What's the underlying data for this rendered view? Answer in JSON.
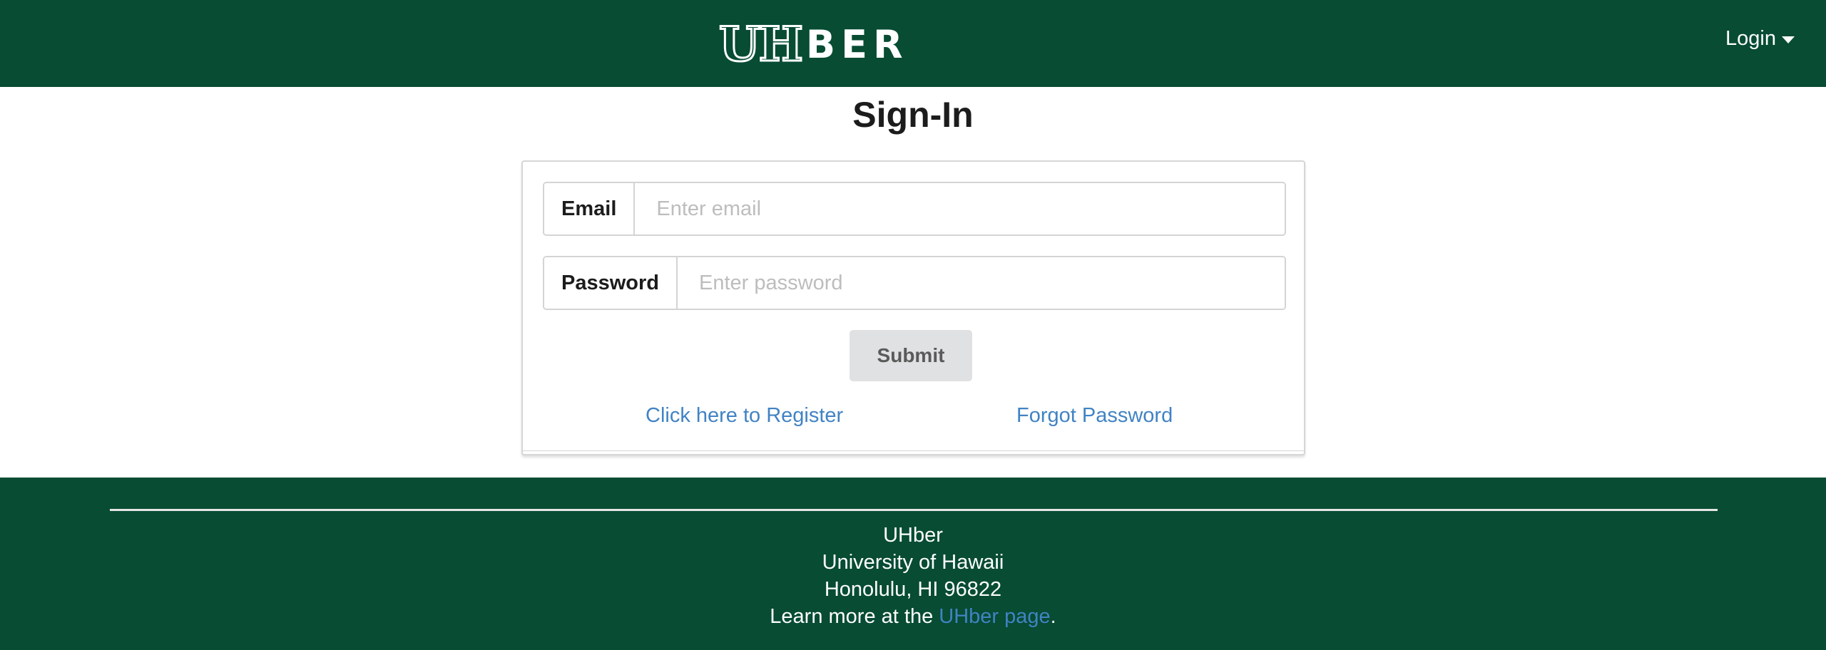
{
  "header": {
    "logo_text": "UHBER",
    "logo_u": "U",
    "logo_h": "H",
    "logo_rest": "BER",
    "login_label": "Login"
  },
  "page": {
    "title": "Sign-In"
  },
  "form": {
    "email_label": "Email",
    "email_placeholder": "Enter email",
    "email_value": "",
    "password_label": "Password",
    "password_placeholder": "Enter password",
    "password_value": "",
    "submit_label": "Submit",
    "register_link": "Click here to Register",
    "forgot_link": "Forgot Password"
  },
  "footer": {
    "line1": "UHber",
    "line2": "University of Hawaii",
    "line3": "Honolulu, HI 96822",
    "learn_prefix": "Learn more at the ",
    "learn_link": "UHber page",
    "learn_suffix": "."
  },
  "colors": {
    "brand_green": "#074c33",
    "link_blue": "#4183c4",
    "button_gray": "#e0e1e2"
  },
  "icons": {
    "login_caret": "caret-down-icon"
  }
}
